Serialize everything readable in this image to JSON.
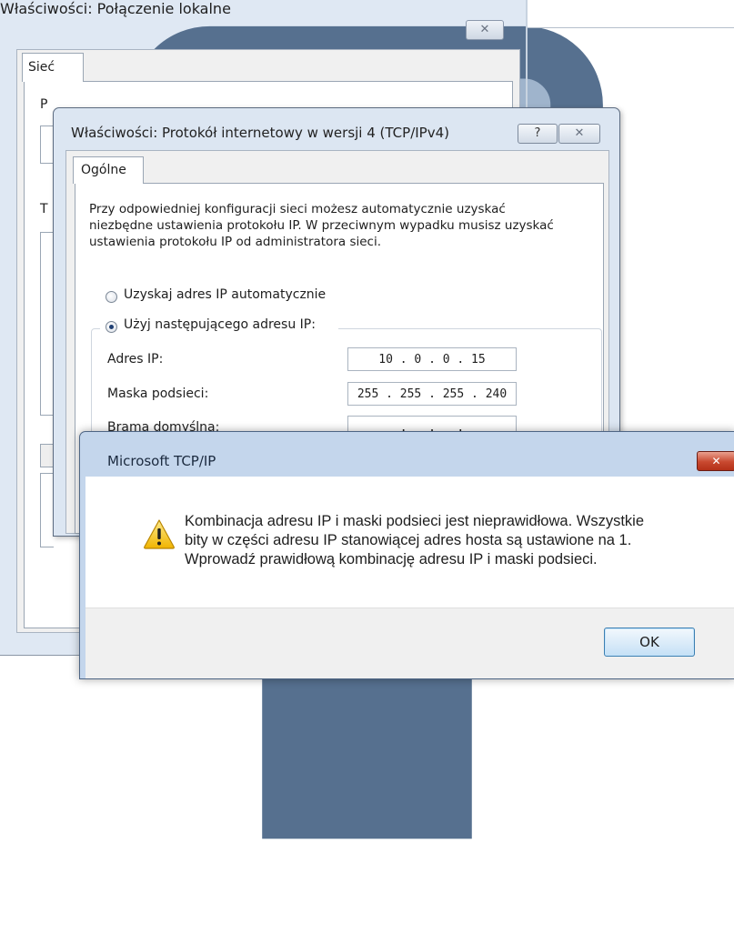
{
  "background_window": {
    "title": "Właściwości: Połączenie lokalne",
    "close_symbol": "✕",
    "tab_label": "Sieć",
    "fragment_1": "P",
    "fragment_2": "T"
  },
  "tcp_dialog": {
    "title": "Właściwości: Protokół internetowy w wersji 4 (TCP/IPv4)",
    "help_symbol": "?",
    "close_symbol": "✕",
    "tab_label": "Ogólne",
    "description": "Przy odpowiedniej konfiguracji sieci możesz automatycznie uzyskać niezbędne ustawienia protokołu IP. W przeciwnym wypadku musisz uzyskać ustawienia protokołu IP od administratora sieci.",
    "radio_auto_label": "Uzyskaj adres IP automatycznie",
    "radio_manual_label": "Użyj następującego adresu IP:",
    "selected_option": "manual",
    "fields": {
      "ip_label": "Adres IP:",
      "ip_value": "10 . 0 . 0 . 15",
      "mask_label": "Maska podsieci:",
      "mask_value": "255 . 255 . 255 . 240",
      "gateway_label": "Brama domyślna:",
      "gateway_value": ".   .   ."
    }
  },
  "error_dialog": {
    "title": "Microsoft TCP/IP",
    "close_symbol": "✕",
    "icon": "warning-icon",
    "message_line1": "Kombinacja adresu IP i maski podsieci jest nieprawidłowa. Wszystkie",
    "message_line2": "bity w części adresu IP stanowiącej adres hosta są ustawione na 1.",
    "message_line3": "Wprowadź prawidłową kombinację adresu IP i maski podsieci.",
    "ok_label": "OK"
  },
  "colors": {
    "frame": "#dce6f2",
    "error_frame": "#c4d6ec",
    "close_red": "#c8482f",
    "warning_yellow": "#f5c518"
  }
}
